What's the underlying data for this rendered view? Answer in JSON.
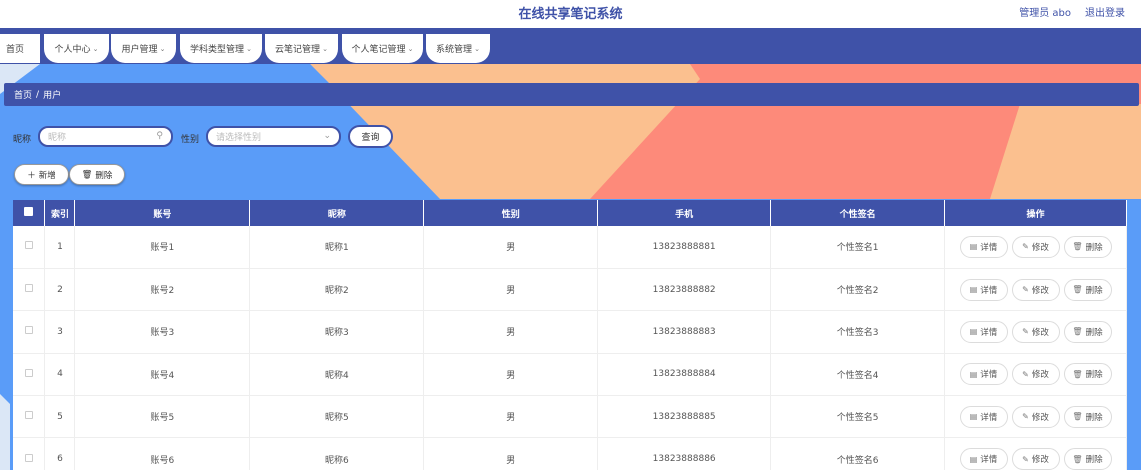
{
  "header": {
    "title": "在线共享笔记系统",
    "user": "管理员 abo",
    "logout": "退出登录"
  },
  "nav": {
    "home": "首页",
    "items": [
      {
        "label": "个人中心"
      },
      {
        "label": "用户管理"
      },
      {
        "label": "学科类型管理"
      },
      {
        "label": "云笔记管理"
      },
      {
        "label": "个人笔记管理"
      },
      {
        "label": "系统管理"
      }
    ]
  },
  "breadcrumb": {
    "home": "首页",
    "sep": "/",
    "current": "用户"
  },
  "search": {
    "nickname_label": "昵称",
    "nickname_placeholder": "昵称",
    "gender_label": "性别",
    "gender_placeholder": "请选择性别",
    "query": "查询"
  },
  "actions": {
    "add": "新增",
    "delete": "删除"
  },
  "table": {
    "headers": [
      "索引",
      "账号",
      "昵称",
      "性别",
      "手机",
      "个性签名",
      "操作"
    ],
    "rows": [
      {
        "index": "1",
        "account": "账号1",
        "nickname": "昵称1",
        "gender": "男",
        "phone": "13823888881",
        "signature": "个性签名1"
      },
      {
        "index": "2",
        "account": "账号2",
        "nickname": "昵称2",
        "gender": "男",
        "phone": "13823888882",
        "signature": "个性签名2"
      },
      {
        "index": "3",
        "account": "账号3",
        "nickname": "昵称3",
        "gender": "男",
        "phone": "13823888883",
        "signature": "个性签名3"
      },
      {
        "index": "4",
        "account": "账号4",
        "nickname": "昵称4",
        "gender": "男",
        "phone": "13823888884",
        "signature": "个性签名4"
      },
      {
        "index": "5",
        "account": "账号5",
        "nickname": "昵称5",
        "gender": "男",
        "phone": "13823888885",
        "signature": "个性签名5"
      },
      {
        "index": "6",
        "account": "账号6",
        "nickname": "昵称6",
        "gender": "男",
        "phone": "13823888886",
        "signature": "个性签名6"
      }
    ],
    "ops": {
      "detail": "详情",
      "edit": "修改",
      "delete": "删除"
    }
  },
  "colors": {
    "primary": "#3f52a8",
    "bg_blue": "#5a9cf8",
    "bg_peach": "#fbc08f",
    "bg_salmon": "#fd8a7a",
    "bg_light": "#dbe7f6"
  }
}
